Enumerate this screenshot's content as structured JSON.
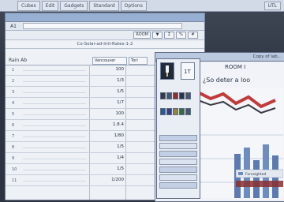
{
  "menubar": {
    "items": [
      "Cubes",
      "Edit",
      "Gadgets",
      "Standard",
      "Options"
    ],
    "right_label": "UTL"
  },
  "spreadsheet": {
    "title": "",
    "cell_ref": "A1",
    "toolbar": [
      "ROOM",
      "▼",
      "Σ",
      "%",
      "#"
    ],
    "row_title": "Co-Solar-ad-Intl-Rates-1-2",
    "column_header": {
      "label": "Rain Ab",
      "col_a": "Vancouver",
      "col_b": "Tori"
    },
    "rows": [
      {
        "n": "1",
        "v": "100"
      },
      {
        "n": "2",
        "v": "1/3"
      },
      {
        "n": "3",
        "v": "1/5"
      },
      {
        "n": "4",
        "v": "1/7"
      },
      {
        "n": "5",
        "v": "100"
      },
      {
        "n": "6",
        "v": "1.8.4"
      },
      {
        "n": "7",
        "v": "1/80"
      },
      {
        "n": "8",
        "v": "1/5"
      },
      {
        "n": "9",
        "v": "1/4"
      },
      {
        "n": "10",
        "v": "1/5"
      },
      {
        "n": "11",
        "v": "1/200"
      }
    ]
  },
  "chart_window": {
    "title": "Copy of lab...",
    "heading": "ROOM I",
    "subheading": "¿So deter a loo",
    "legend_label": "Foresighted"
  },
  "palette": {
    "tool_colors": [
      "#333a48",
      "#4a5670",
      "#8a3030",
      "#2a3448",
      "#2a5a8a",
      "#3a3a8a",
      "#8a8a3a",
      "#3a6a3a"
    ]
  }
}
